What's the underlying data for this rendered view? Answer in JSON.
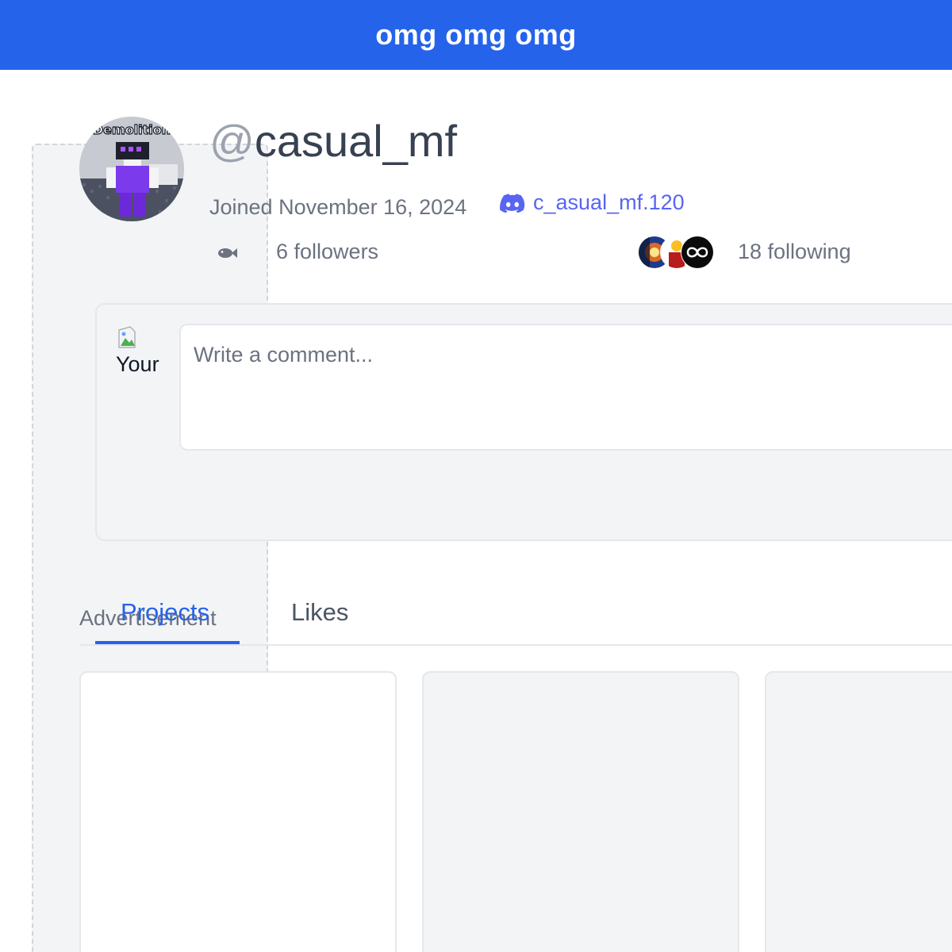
{
  "banner": {
    "text": "omg omg omg",
    "color": "#2563eb"
  },
  "advertisement": {
    "label": "Advertisement"
  },
  "profile": {
    "avatar_caption": "Demolition",
    "username_prefix": "@",
    "username": "casual_mf",
    "joined": "Joined November 16, 2024",
    "discord_handle": "c_asual_mf.120",
    "followers": "6 followers",
    "following": "18 following"
  },
  "comment": {
    "your_avatar_alt": "Your",
    "placeholder": "Write a comment..."
  },
  "tabs": [
    {
      "label": "Projects",
      "active": true
    },
    {
      "label": "Likes",
      "active": false
    }
  ],
  "colors": {
    "accent": "#2563eb",
    "discord": "#5865f2",
    "muted_text": "#6b7280"
  },
  "icons": {
    "discord": "discord-icon",
    "followers": "fish-icon",
    "broken_image": "broken-image-icon"
  }
}
